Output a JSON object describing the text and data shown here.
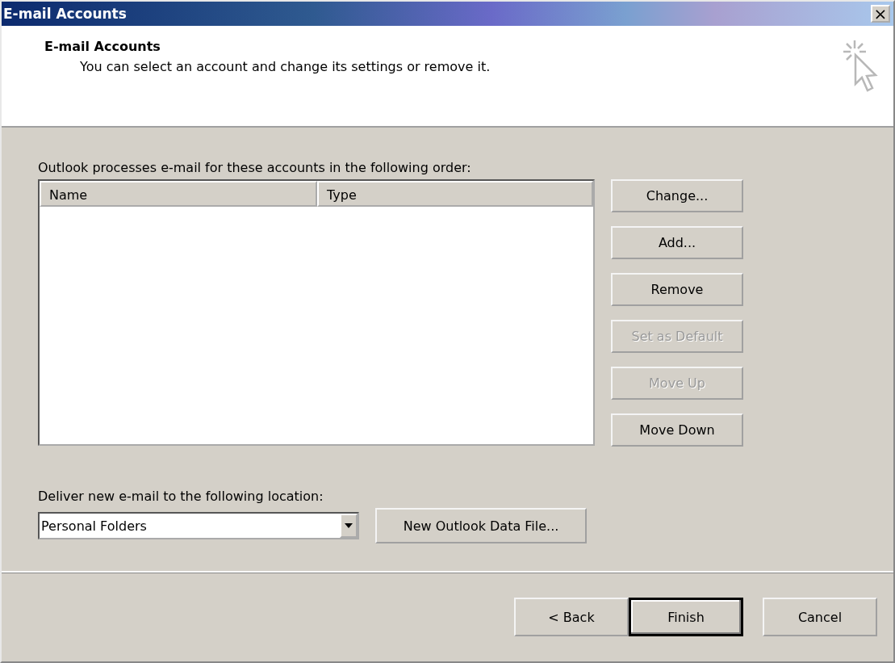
{
  "window": {
    "title": "E-mail Accounts",
    "close_glyph": "×"
  },
  "header": {
    "title": "E-mail Accounts",
    "subtitle": "You can select an account and change its settings or remove it."
  },
  "accounts": {
    "label": "Outlook processes e-mail for these accounts in the following order:",
    "columns": [
      "Name",
      "Type"
    ],
    "buttons": [
      {
        "label": "Change...",
        "disabled": false
      },
      {
        "label": "Add...",
        "disabled": false
      },
      {
        "label": "Remove",
        "disabled": false
      },
      {
        "label": "Set as Default",
        "disabled": true
      },
      {
        "label": "Move Up",
        "disabled": true
      },
      {
        "label": "Move Down",
        "disabled": false
      }
    ]
  },
  "delivery": {
    "label": "Deliver new e-mail to the following location:",
    "value": "Personal Folders",
    "button": "New Outlook Data File..."
  },
  "footer_buttons": [
    {
      "label": "< Back",
      "default": false
    },
    {
      "label": "Finish",
      "default": true
    },
    {
      "label": "Cancel",
      "default": false
    }
  ]
}
